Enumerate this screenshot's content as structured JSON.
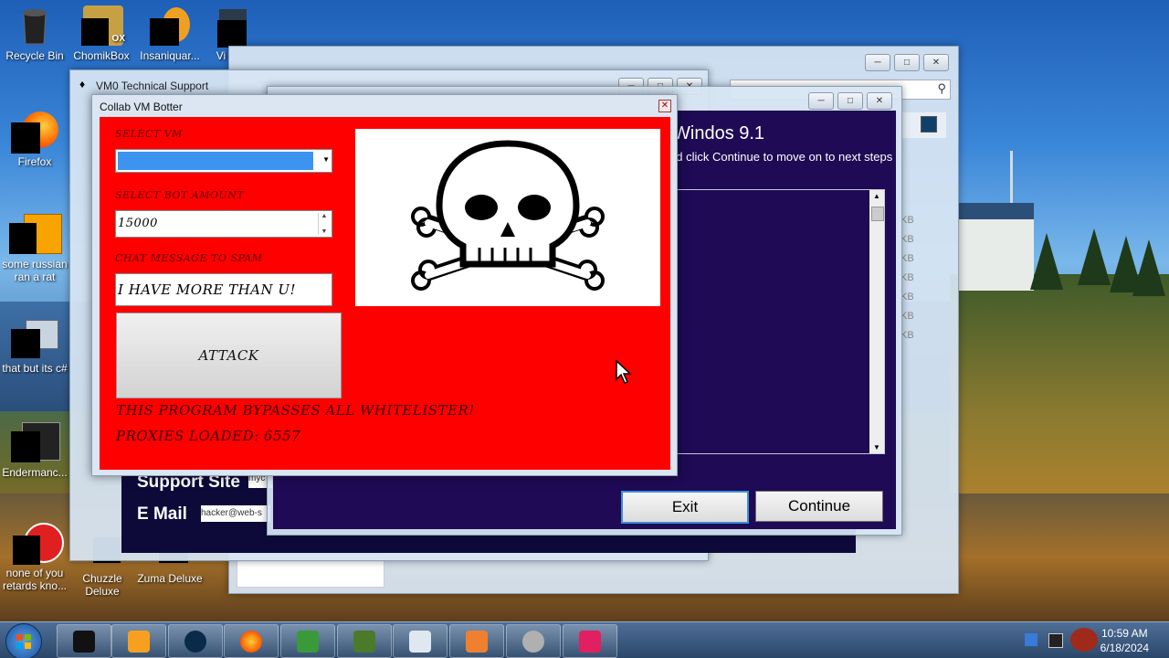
{
  "desktop": {
    "icons": [
      {
        "label": "Recycle Bin"
      },
      {
        "label": "ChomikBox",
        "badge": "OX"
      },
      {
        "label": "Insaniquar..."
      },
      {
        "label": "Vi"
      },
      {
        "label": "Firefox"
      },
      {
        "label": "some russian ran a rat"
      },
      {
        "label": "that but its c#"
      },
      {
        "label": "Endermanc..."
      },
      {
        "label": "none of you retards kno..."
      },
      {
        "label": "Chuzzle Deluxe"
      },
      {
        "label": "Zuma Deluxe"
      }
    ]
  },
  "windows": {
    "back_window": {
      "kb_labels": [
        "KB",
        "KB",
        "KB",
        "KB",
        "KB",
        "KB",
        "KB"
      ]
    },
    "support_window": {
      "title": "VM0 Technical Support",
      "support_site_label": "Support Site",
      "support_site_value": "myc",
      "email_label": "E Mail",
      "email_value": "hacker@web-s"
    },
    "installer": {
      "heading": "Windos 9.1",
      "subtext": "nd click Continue to move on to next steps",
      "exit_label": "Exit",
      "continue_label": "Continue"
    },
    "botter": {
      "title": "Collab VM Botter",
      "select_vm_label": "SELECT VM",
      "select_vm_value": "",
      "bot_amount_label": "SELECT BOT AMOUNT",
      "bot_amount_value": "15000",
      "chat_label": "CHAT MESSAGE TO SPAM",
      "chat_value": "I HAVE MORE THAN U!",
      "attack_label": "ATTACK",
      "bypass_text": "THIS PROGRAM BYPASSES ALL WHITELISTER!",
      "proxies_text": "PROXIES LOADED: 6557"
    }
  },
  "taskbar": {
    "clock_time": "10:59 AM",
    "clock_date": "6/18/2024"
  },
  "colors": {
    "botter_red": "#ff0000",
    "installer_purple": "#1e0a55",
    "combo_blue": "#3c94f0"
  }
}
